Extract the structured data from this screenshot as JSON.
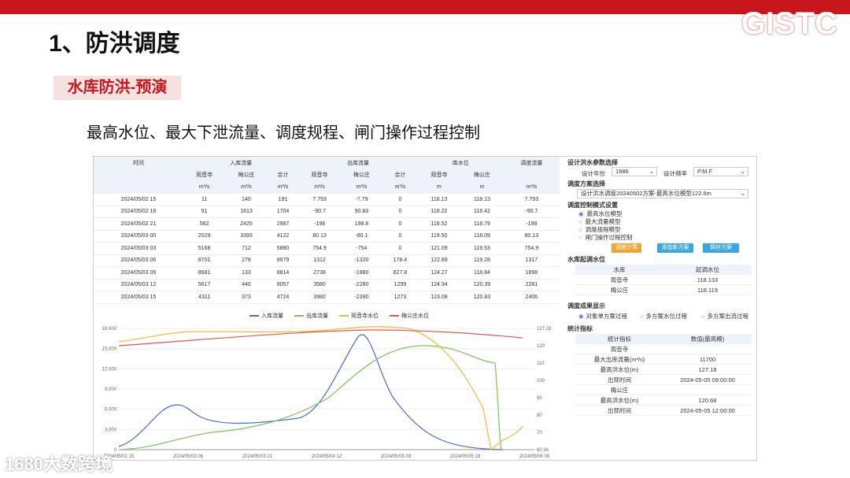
{
  "header": {
    "logo": "GISTC",
    "title": "1、防洪调度",
    "tag": "水库防洪-预演",
    "caption": "最高水位、最大下泄流量、调度规程、闸门操作过程控制"
  },
  "table": {
    "group_headers": [
      "时间",
      "入库流量",
      "出库流量",
      "库水位",
      "调度流量"
    ],
    "sub_headers": [
      "",
      "观音寺",
      "梅公庄",
      "合计",
      "观音寺",
      "梅公庄",
      "合计",
      "观音寺",
      "梅公庄",
      ""
    ],
    "units": [
      "",
      "m³/s",
      "m³/s",
      "m³/s",
      "m³/s",
      "m³/s",
      "m³/s",
      "m",
      "m",
      "m³/s"
    ],
    "rows": [
      [
        "2024/05/02 15",
        "11",
        "140",
        "191",
        "7.793",
        "-7.79",
        "0",
        "118.13",
        "118.13",
        "7.793"
      ],
      [
        "2024/05/02 18",
        "91",
        "1613",
        "1704",
        "-90.7",
        "90.83",
        "0",
        "118.22",
        "118.42",
        "-90.7"
      ],
      [
        "2024/05/02 21",
        "562",
        "2425",
        "2987",
        "-198",
        "198.8",
        "0",
        "118.52",
        "118.79",
        "-198"
      ],
      [
        "2024/05/03 00",
        "2029",
        "3393",
        "4122",
        "80.13",
        "-80.1",
        "0",
        "119.50",
        "118.09",
        "80.13"
      ],
      [
        "2024/05/03 03",
        "5168",
        "712",
        "5880",
        "754.9",
        "-754",
        "0",
        "121.09",
        "119.53",
        "754.9"
      ],
      [
        "2024/05/03 06",
        "8701",
        "278",
        "8979",
        "1312",
        "-1320",
        "178.4",
        "122.89",
        "119.28",
        "1317"
      ],
      [
        "2024/05/03 09",
        "8681",
        "133",
        "8814",
        "2738",
        "-1880",
        "827.8",
        "124.27",
        "118.84",
        "1898"
      ],
      [
        "2024/05/03 12",
        "5617",
        "440",
        "8057",
        "3580",
        "-2280",
        "1299",
        "124.94",
        "120.39",
        "2281"
      ],
      [
        "2024/05/03 15",
        "4311",
        "373",
        "4724",
        "3980",
        "-2390",
        "1273",
        "123.08",
        "120.83",
        "2406"
      ]
    ]
  },
  "legend": [
    {
      "label": "入库流量",
      "color": "#4a6cd4"
    },
    {
      "label": "出库流量",
      "color": "#7cc45a"
    },
    {
      "label": "观音寺水位",
      "color": "#f5b93b"
    },
    {
      "label": "梅公庄水位",
      "color": "#e05a4a"
    }
  ],
  "chart_data": {
    "type": "line",
    "x": [
      "2024/05/02 15",
      "2024/05/03 06",
      "2024/05/03 21",
      "2024/05/04 12",
      "2024/05/05 03",
      "2024/05/05 18",
      "2024/05/06 09"
    ],
    "yleft_unit": "m³/s",
    "yright_unit": "m",
    "yleft_ticks": [
      "0",
      "3,000",
      "6,000",
      "9,000",
      "12,000",
      "15,000",
      "18,000"
    ],
    "yright_ticks": [
      "60.34",
      "70",
      "80",
      "90",
      "100",
      "110",
      "120",
      "127.28"
    ],
    "ylim_left": [
      0,
      18000
    ],
    "ylim_right": [
      60.34,
      127.28
    ]
  },
  "side": {
    "s1": "设计洪水参数选择",
    "year_label": "设计年份",
    "year_val": "1986",
    "freq_label": "设计频率",
    "freq_val": "P.M.F",
    "s2": "调度方案选择",
    "plan": "设计洪水调度20240502方案-最高水位模型122.6m",
    "s3": "调度控制模式设置",
    "modes": [
      "最高水位模型",
      "最大流量模型",
      "调度规程模型",
      "闸门操作过程控制"
    ],
    "btns": [
      "调度计算",
      "添加新方案",
      "保存方案"
    ],
    "s4": "水库起调水位",
    "tbl1_head": [
      "水库",
      "起调水位"
    ],
    "tbl1": [
      [
        "观音寺",
        "118.133"
      ],
      [
        "梅公庄",
        "118.119"
      ]
    ],
    "s5": "调度成果显示",
    "opts": [
      "对象单方案过程",
      "多方案水位过程",
      "多方案出流过程"
    ],
    "s6": "统计指标",
    "tbl2_head": [
      "统计指标",
      "数值(最高模)"
    ],
    "tbl2": [
      [
        "观音寺",
        ""
      ],
      [
        "最大出库流量(m³/s)",
        "11700"
      ],
      [
        "最高洪水位(m)",
        "127.18"
      ],
      [
        "出现时间",
        "2024-05-05 09:00:00"
      ],
      [
        "梅公庄",
        ""
      ],
      [
        "最高洪水位(m)",
        "120.68"
      ],
      [
        "出现时间",
        "2024-05-05 12:00:00"
      ]
    ]
  },
  "watermark": "1680大数跨境"
}
